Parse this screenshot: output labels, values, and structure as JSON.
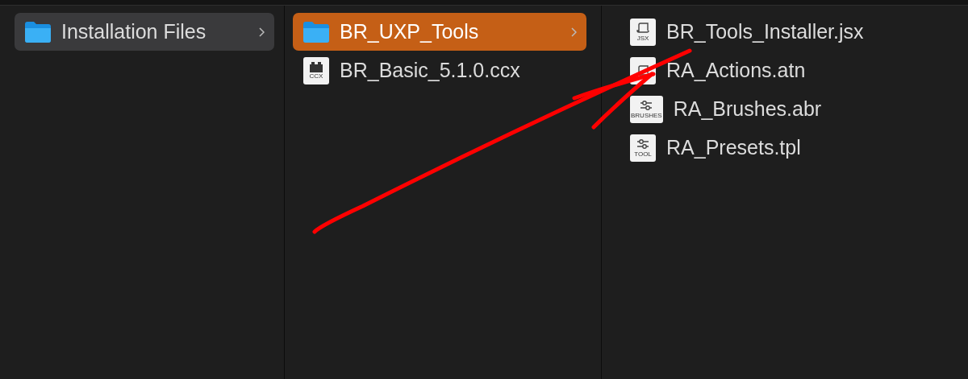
{
  "columns": [
    {
      "active": false,
      "items": [
        {
          "name": "Installation Files",
          "kind": "folder",
          "selected": true,
          "expandable": true
        }
      ]
    },
    {
      "active": true,
      "items": [
        {
          "name": "BR_UXP_Tools",
          "kind": "folder",
          "selected": true,
          "expandable": true
        },
        {
          "name": "BR_Basic_5.1.0.ccx",
          "kind": "brick",
          "badge": "CCX",
          "selected": false,
          "expandable": false
        }
      ]
    },
    {
      "items": [
        {
          "name": "BR_Tools_Installer.jsx",
          "kind": "scroll",
          "badge": "JSX",
          "selected": false,
          "expandable": false
        },
        {
          "name": "RA_Actions.atn",
          "kind": "scroll",
          "selected": false,
          "expandable": false
        },
        {
          "name": "RA_Brushes.abr",
          "kind": "sliders",
          "badge": "BRUSHES",
          "selected": false,
          "expandable": false
        },
        {
          "name": "RA_Presets.tpl",
          "kind": "sliders",
          "badge": "TOOL",
          "selected": false,
          "expandable": false
        }
      ]
    }
  ],
  "annotation": {
    "kind": "arrow",
    "color": "#ff0000"
  }
}
